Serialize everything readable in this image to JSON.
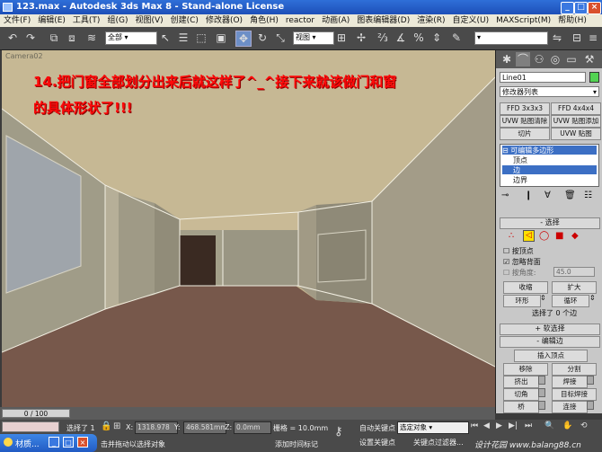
{
  "window": {
    "title": "123.max - Autodesk 3ds Max 8 - Stand-alone License"
  },
  "menu": [
    "文件(F)",
    "编辑(E)",
    "工具(T)",
    "组(G)",
    "视图(V)",
    "创建(C)",
    "修改器(O)",
    "角色(H)",
    "reactor",
    "动画(A)",
    "图表编辑器(D)",
    "渲染(R)",
    "自定义(U)",
    "MAXScript(M)",
    "帮助(H)"
  ],
  "toolbar": {
    "selection_filter": "全部",
    "ref_coord": "视图"
  },
  "viewport": {
    "label": "Camera02",
    "caption_line1": "14.把门窗全部划分出来后就这样了^_^接下来就该做门和窗",
    "caption_line2": "的具体形状了!!!"
  },
  "panel": {
    "object_name": "Line01",
    "modifier_list": "修改器列表",
    "buttons": [
      "FFD 3x3x3",
      "FFD 4x4x4",
      "UVW 贴图清除",
      "UVW 贴图添加",
      "切片",
      "UVW 贴图"
    ],
    "stack": [
      "可编辑多边形",
      "顶点",
      "边",
      "边界"
    ],
    "selection_header": "选择",
    "by_vertex": "按顶点",
    "ignore_backfacing": "忽略背面",
    "by_angle": "按角度:",
    "angle_value": "45.0",
    "shrink": "收缩",
    "grow": "扩大",
    "ring": "环形",
    "loop": "循环",
    "selected_info": "选择了 0 个边",
    "soft_selection": "软选择",
    "edit_edges": "编辑边",
    "insert_vertex": "插入顶点",
    "remove": "移除",
    "split": "分割",
    "extrude": "挤出",
    "weld": "焊接",
    "chamfer": "切角",
    "target_weld": "目标焊接",
    "bridge": "桥",
    "connect": "连接"
  },
  "timeline": {
    "position": "0 / 100"
  },
  "status": {
    "selection": "选择了 1",
    "x_label": "X:",
    "x_value": "1318.978",
    "y_label": "Y:",
    "y_value": "468.581mm",
    "z_label": "Z:",
    "z_value": "0.0mm",
    "grid": "栅格 = 10.0mm",
    "auto_key": "自动关键点",
    "selected_object": "选定对象",
    "set_key": "设置关键点",
    "key_filter": "关键点过滤器...",
    "prompt": "击并拖动以选择对象",
    "add_time_tag": "添加时间标记",
    "taskbar_item": "材质..."
  },
  "watermark": "设计花园 www.balang88.cn"
}
